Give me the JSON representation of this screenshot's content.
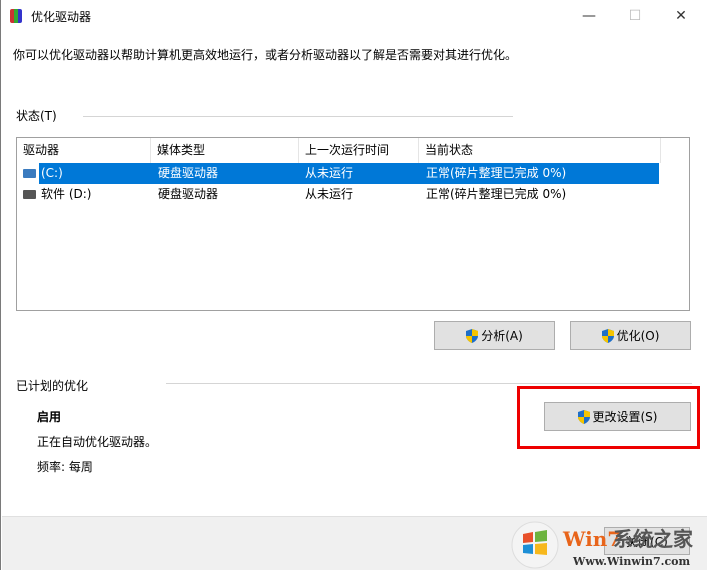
{
  "window": {
    "title": "优化驱动器",
    "minimize": "—",
    "maximize": "☐",
    "close": "✕"
  },
  "description": "你可以优化驱动器以帮助计算机更高效地运行，或者分析驱动器以了解是否需要对其进行优化。",
  "status": {
    "label": "状态(T)",
    "columns": [
      "驱动器",
      "媒体类型",
      "上一次运行时间",
      "当前状态"
    ],
    "rows": [
      {
        "drive": "(C:)",
        "media": "硬盘驱动器",
        "last_run": "从未运行",
        "state": "正常(碎片整理已完成 0%)",
        "selected": true
      },
      {
        "drive": "软件 (D:)",
        "media": "硬盘驱动器",
        "last_run": "从未运行",
        "state": "正常(碎片整理已完成 0%)",
        "selected": false
      }
    ],
    "analyze_button": "分析(A)",
    "optimize_button": "优化(O)"
  },
  "scheduled": {
    "label": "已计划的优化",
    "state": "启用",
    "detail": "正在自动优化驱动器。",
    "frequency": "频率: 每周",
    "change_settings_button": "更改设置(S)"
  },
  "footer": {
    "close_button": "关闭(C)"
  },
  "watermark": {
    "title": "Win7系统之家",
    "url": "Www.Winwin7.com"
  },
  "colors": {
    "selection": "#0078d7",
    "highlight_box": "#ee0000"
  }
}
